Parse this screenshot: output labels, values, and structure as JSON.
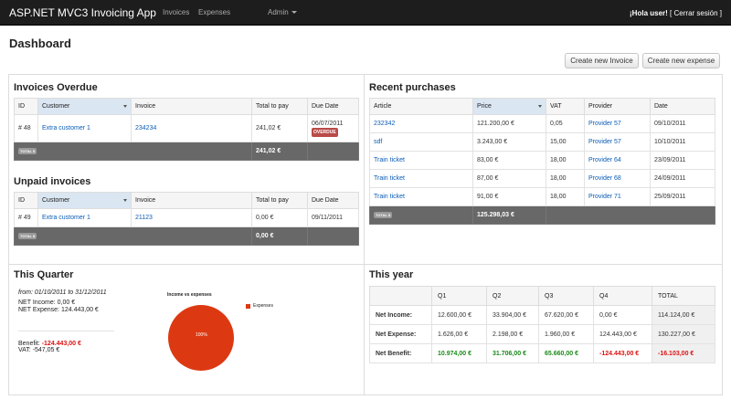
{
  "navbar": {
    "brand": "ASP.NET MVC3 Invoicing App",
    "links": [
      "Invoices",
      "Expenses"
    ],
    "admin_label": "Admin",
    "greeting": "¡Hola user!",
    "logout_open": "[",
    "logout_label": "Cerrar sesión",
    "logout_close": "]"
  },
  "page": {
    "title": "Dashboard",
    "create_invoice_label": "Create new Invoice",
    "create_expense_label": "Create new expense"
  },
  "invoices_overdue": {
    "title": "Invoices Overdue",
    "columns": [
      "ID",
      "Customer",
      "Invoice",
      "Total to pay",
      "Due Date"
    ],
    "rows": [
      {
        "id": "# 48",
        "customer": "Extra customer 1",
        "invoice": "234234",
        "total": "241,02 €",
        "due": "06/07/2011",
        "badge": "OVERDUE"
      }
    ],
    "total_badge": "TOTAL $",
    "total_value": "241,02 €"
  },
  "unpaid_invoices": {
    "title": "Unpaid invoices",
    "columns": [
      "ID",
      "Customer",
      "Invoice",
      "Total to pay",
      "Due Date"
    ],
    "rows": [
      {
        "id": "# 49",
        "customer": "Extra customer 1",
        "invoice": "21123",
        "total": "0,00 €",
        "due": "09/11/2011"
      }
    ],
    "total_badge": "TOTAL $",
    "total_value": "0,00 €"
  },
  "recent_purchases": {
    "title": "Recent purchases",
    "columns": [
      "Article",
      "Price",
      "VAT",
      "Provider",
      "Date"
    ],
    "rows": [
      {
        "article": "232342",
        "price": "121.200,00 €",
        "vat": "0,05",
        "provider": "Provider 57",
        "date": "09/10/2011"
      },
      {
        "article": "sdf",
        "price": "3.243,00 €",
        "vat": "15,00",
        "provider": "Provider 57",
        "date": "10/10/2011"
      },
      {
        "article": "Train ticket",
        "price": "83,00 €",
        "vat": "18,00",
        "provider": "Provider 64",
        "date": "23/09/2011"
      },
      {
        "article": "Train ticket",
        "price": "87,00 €",
        "vat": "18,00",
        "provider": "Provider 68",
        "date": "24/09/2011"
      },
      {
        "article": "Train ticket",
        "price": "91,00 €",
        "vat": "18,00",
        "provider": "Provider 71",
        "date": "25/09/2011"
      }
    ],
    "total_badge": "TOTAL $",
    "total_value": "125.298,03 €"
  },
  "this_quarter": {
    "title": "This Quarter",
    "period": "from: 01/10/2011 to 31/12/2011",
    "net_income": "NET Income: 0,00 €",
    "net_expense": "NET Expense: 124.443,00 €",
    "benefit_label": "Benefit:",
    "benefit_value": "-124.443,00 €",
    "vat": "VAT: -547,05 €",
    "chart_title": "Income vs expenses",
    "chart_slice_label": "100%",
    "legend_label": "Expenses",
    "slice_color": "#dc3912"
  },
  "this_year": {
    "title": "This year",
    "columns": [
      "",
      "Q1",
      "Q2",
      "Q3",
      "Q4",
      "TOTAL"
    ],
    "rows": [
      {
        "label": "Net Income:",
        "values": [
          "12.600,00 €",
          "33.904,00 €",
          "67.620,00 €",
          "0,00 €",
          "114.124,00 €"
        ]
      },
      {
        "label": "Net Expense:",
        "values": [
          "1.626,00 €",
          "2.198,00 €",
          "1.960,00 €",
          "124.443,00 €",
          "130.227,00 €"
        ]
      },
      {
        "label": "Net Benefit:",
        "values": [
          "10.974,00 €",
          "31.706,00 €",
          "65.660,00 €",
          "-124.443,00 €",
          "-16.103,00 €"
        ]
      }
    ]
  },
  "colors": {
    "navbar": "#1d1d1d",
    "link": "#0b5cb5",
    "total_row": "#686868",
    "overdue": "#b94a48",
    "positive": "#1a8a1a",
    "negative": "#dd1111"
  }
}
